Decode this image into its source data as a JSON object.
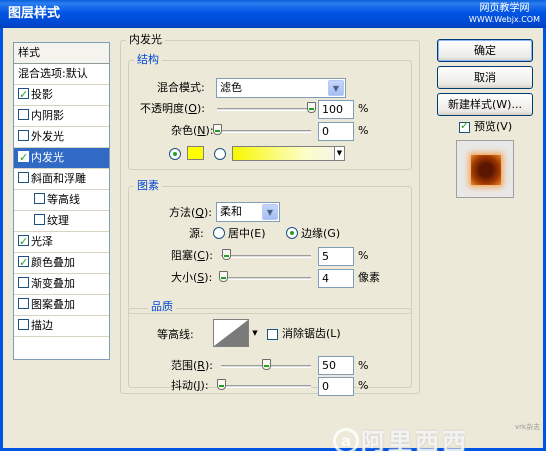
{
  "window": {
    "title": "图层样式",
    "watermark_top_line1": "网页教学网",
    "watermark_top_line2": "WWW.Webjx.COM"
  },
  "sidebar": {
    "header": "样式",
    "items": [
      {
        "label": "混合选项:默认",
        "has_checkbox": false,
        "checked": false,
        "selected": false,
        "indent": false
      },
      {
        "label": "投影",
        "has_checkbox": true,
        "checked": true,
        "selected": false,
        "indent": false
      },
      {
        "label": "内阴影",
        "has_checkbox": true,
        "checked": false,
        "selected": false,
        "indent": false
      },
      {
        "label": "外发光",
        "has_checkbox": true,
        "checked": false,
        "selected": false,
        "indent": false
      },
      {
        "label": "内发光",
        "has_checkbox": true,
        "checked": true,
        "selected": true,
        "indent": false
      },
      {
        "label": "斜面和浮雕",
        "has_checkbox": true,
        "checked": false,
        "selected": false,
        "indent": false
      },
      {
        "label": "等高线",
        "has_checkbox": true,
        "checked": false,
        "selected": false,
        "indent": true
      },
      {
        "label": "纹理",
        "has_checkbox": true,
        "checked": false,
        "selected": false,
        "indent": true
      },
      {
        "label": "光泽",
        "has_checkbox": true,
        "checked": true,
        "selected": false,
        "indent": false
      },
      {
        "label": "颜色叠加",
        "has_checkbox": true,
        "checked": true,
        "selected": false,
        "indent": false
      },
      {
        "label": "渐变叠加",
        "has_checkbox": true,
        "checked": false,
        "selected": false,
        "indent": false
      },
      {
        "label": "图案叠加",
        "has_checkbox": true,
        "checked": false,
        "selected": false,
        "indent": false
      },
      {
        "label": "描边",
        "has_checkbox": true,
        "checked": false,
        "selected": false,
        "indent": false
      }
    ]
  },
  "panel": {
    "title": "内发光",
    "structure": {
      "title": "结构",
      "blend_mode_label": "混合模式:",
      "blend_mode_value": "滤色",
      "opacity_label": "不透明度(",
      "opacity_key": "O",
      "opacity_value": "100",
      "opacity_fraction": 1.0,
      "noise_label": "杂色(",
      "noise_key": "N",
      "noise_value": "0",
      "noise_fraction": 0.0,
      "unit_percent": "%",
      "glow_color": "#ffff00"
    },
    "elements": {
      "title": "图素",
      "technique_label": "方法(",
      "technique_key": "Q",
      "technique_value": "柔和",
      "source_label": "源:",
      "source_center": "居中(E)",
      "source_edge": "边缘(G)",
      "choke_label": "阻塞(",
      "choke_key": "C",
      "choke_value": "5",
      "choke_fraction": 0.05,
      "size_label": "大小(",
      "size_key": "S",
      "size_value": "4",
      "size_fraction": 0.02,
      "unit_percent": "%",
      "unit_pixels": "像素"
    },
    "quality": {
      "title": "品质",
      "contour_label": "等高线:",
      "antialias_label": "消除锯齿(L)",
      "range_label": "范围(",
      "range_key": "R",
      "range_value": "50",
      "range_fraction": 0.5,
      "jitter_label": "抖动(",
      "jitter_key": "J",
      "jitter_value": "0",
      "jitter_fraction": 0.0,
      "unit_percent": "%"
    }
  },
  "buttons": {
    "ok": "确定",
    "cancel": "取消",
    "new_style": "新建样式(W)...",
    "preview_label": "预览(V)"
  },
  "watermark_bottom": {
    "logo": "a",
    "text": "阿里西西",
    "small": "vrk杂志"
  }
}
